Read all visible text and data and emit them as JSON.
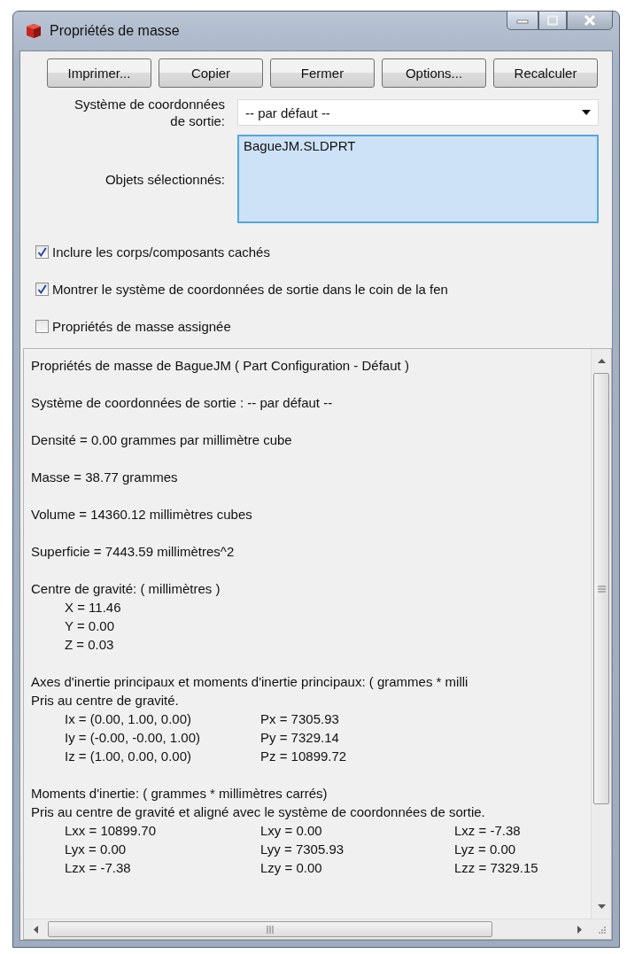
{
  "window": {
    "title": "Propriétés de masse"
  },
  "buttons": [
    "Imprimer...",
    "Copier",
    "Fermer",
    "Options...",
    "Recalculer"
  ],
  "coordinate_system": {
    "label": "Système de coordonnées de sortie:",
    "value": "-- par défaut --"
  },
  "selected_objects": {
    "label": "Objets sélectionnés:",
    "items": [
      "BagueJM.SLDPRT"
    ]
  },
  "checkboxes": [
    {
      "label": "Inclure les corps/composants cachés",
      "checked": true
    },
    {
      "label": "Montrer le système de coordonnées de sortie dans le coin de la fen",
      "checked": true
    },
    {
      "label": "Propriétés de masse assignée",
      "checked": false
    }
  ],
  "report": {
    "blocks": [
      [
        {
          "kind": "text",
          "text": "Propriétés de masse de BagueJM ( Part Configuration - Défaut )"
        }
      ],
      [
        {
          "kind": "text",
          "text": "Système de coordonnées de sortie : -- par défaut --"
        }
      ],
      [
        {
          "kind": "text",
          "text": "Densité = 0.00 grammes par millimètre cube"
        }
      ],
      [
        {
          "kind": "text",
          "text": "Masse = 38.77 grammes"
        }
      ],
      [
        {
          "kind": "text",
          "text": "Volume = 14360.12 millimètres cubes"
        }
      ],
      [
        {
          "kind": "text",
          "text": "Superficie = 7443.59 millimètres^2"
        }
      ],
      [
        {
          "kind": "text",
          "text": "Centre de gravité: ( millimètres )"
        },
        {
          "kind": "values",
          "cells": [
            "X = 11.46"
          ]
        },
        {
          "kind": "values",
          "cells": [
            "Y = 0.00"
          ]
        },
        {
          "kind": "values",
          "cells": [
            "Z = 0.03"
          ]
        }
      ],
      [
        {
          "kind": "text",
          "text": "Axes d'inertie principaux et moments d'inertie principaux: ( grammes * milli"
        },
        {
          "kind": "text",
          "text": "Pris au centre de gravité."
        },
        {
          "kind": "values",
          "cells": [
            "Ix = (0.00, 1.00, 0.00)",
            "Px = 7305.93"
          ]
        },
        {
          "kind": "values",
          "cells": [
            "Iy = (-0.00, -0.00, 1.00)",
            "Py = 7329.14"
          ]
        },
        {
          "kind": "values",
          "cells": [
            "Iz = (1.00, 0.00, 0.00)",
            "Pz = 10899.72"
          ]
        }
      ],
      [
        {
          "kind": "text",
          "text": "Moments d'inertie: ( grammes * millimètres carrés)"
        },
        {
          "kind": "text",
          "text": "Pris au centre de gravité et aligné avec le système de coordonnées de sortie."
        },
        {
          "kind": "values",
          "cells": [
            "Lxx = 10899.70",
            "Lxy = 0.00",
            "Lxz = -7.38"
          ]
        },
        {
          "kind": "values",
          "cells": [
            "Lyx = 0.00",
            "Lyy = 7305.93",
            "Lyz = 0.00"
          ]
        },
        {
          "kind": "values",
          "cells": [
            "Lzx = -7.38",
            "Lzy = 0.00",
            "Lzz = 7329.15"
          ]
        }
      ]
    ]
  }
}
